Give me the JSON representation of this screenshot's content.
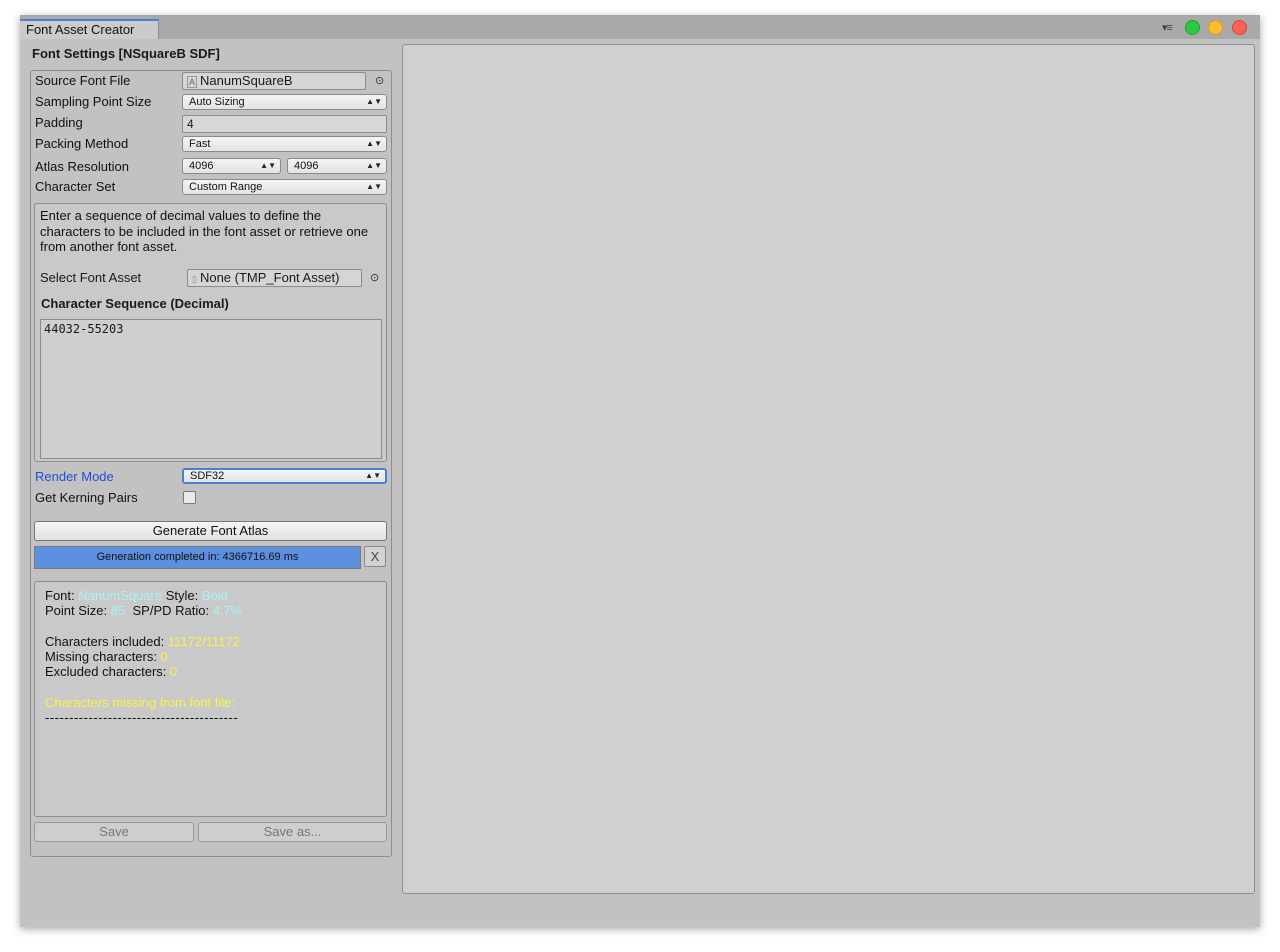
{
  "window": {
    "tab_title": "Font Asset Creator",
    "menu_icon": "menu-lines-icon"
  },
  "settings": {
    "header": "Font Settings [NSquareB SDF]",
    "source_font_file": {
      "label": "Source Font File",
      "value": "NanumSquareB"
    },
    "sampling_point_size": {
      "label": "Sampling Point Size",
      "value": "Auto Sizing"
    },
    "padding": {
      "label": "Padding",
      "value": "4"
    },
    "packing_method": {
      "label": "Packing Method",
      "value": "Fast"
    },
    "atlas_resolution": {
      "label": "Atlas Resolution",
      "width": "4096",
      "height": "4096"
    },
    "character_set": {
      "label": "Character Set",
      "value": "Custom Range"
    },
    "help_text": "Enter a sequence of decimal values to define the characters to be included in the font asset or retrieve one from another font asset.",
    "select_font_asset": {
      "label": "Select Font Asset",
      "value": "None (TMP_Font Asset)"
    },
    "character_sequence": {
      "label": "Character Sequence (Decimal)",
      "value": "44032-55203"
    },
    "render_mode": {
      "label": "Render Mode",
      "value": "SDF32"
    },
    "kerning": {
      "label": "Get Kerning Pairs",
      "checked": false
    },
    "generate_button": "Generate Font Atlas",
    "progress": {
      "text": "Generation completed in: 4366716.69 ms",
      "fraction": 1.0
    },
    "progress_close": "X"
  },
  "report": {
    "font_label": "Font:",
    "font_value": "NanumSquare",
    "style_label": "Style:",
    "style_value": "Bold",
    "point_size_label": "Point Size:",
    "point_size_value": "85",
    "ratio_label": "SP/PD Ratio:",
    "ratio_value": "4.7%",
    "included_label": "Characters included:",
    "included_value": "11172/11172",
    "missing_label": "Missing characters:",
    "missing_value": "0",
    "excluded_label": "Excluded characters:",
    "excluded_value": "0",
    "missing_header": "Characters missing from font file:",
    "separator": "----------------------------------------"
  },
  "actions": {
    "save": "Save",
    "save_as": "Save as..."
  },
  "colors": {
    "accent_blue": "#5c8fe0",
    "render_mode_label": "#1f4fd6",
    "report_cyan": "#a9f2f9",
    "report_yellow": "#f7f24a"
  }
}
